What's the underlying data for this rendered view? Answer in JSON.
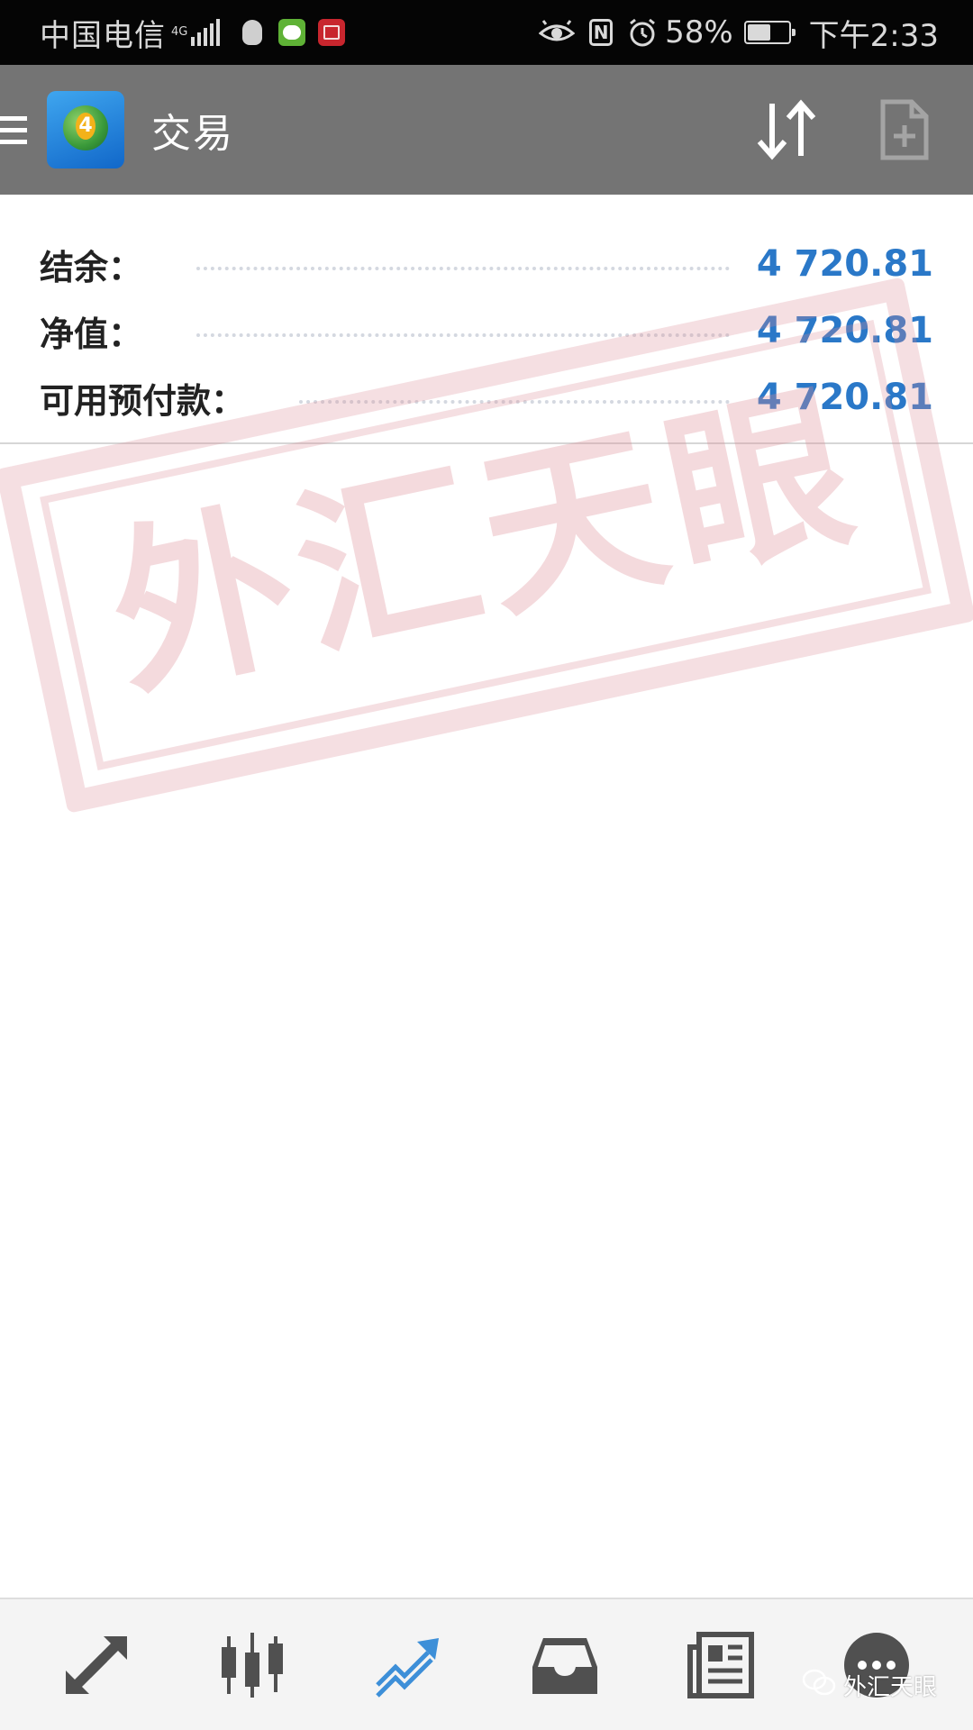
{
  "status_bar": {
    "carrier": "中国电信",
    "network_type": "4G",
    "battery_level": "58%",
    "time": "下午2:33",
    "icons": [
      "signal-icon",
      "qq-icon",
      "pet-app-icon",
      "book-app-icon",
      "eye-icon",
      "nfc-icon",
      "alarm-icon",
      "battery-icon"
    ],
    "nfc_glyph": "N"
  },
  "toolbar": {
    "title": "交易",
    "app_logo_number": "4",
    "icons": [
      "menu-icon",
      "sort-icon",
      "new-order-icon"
    ]
  },
  "account": {
    "rows": [
      {
        "label": "结余：",
        "value": "4 720.81"
      },
      {
        "label": "净值：",
        "value": "4 720.81"
      },
      {
        "label": "可用预付款：",
        "value": "4 720.81"
      }
    ]
  },
  "watermark": {
    "text": "外汇天眼"
  },
  "bottom_nav": {
    "items": [
      "quotes-icon",
      "chart-icon",
      "trade-icon",
      "history-icon",
      "news-icon",
      "more-icon"
    ],
    "active": "trade-icon"
  },
  "footer_credit": {
    "text": "外汇天眼"
  },
  "colors": {
    "toolbar_bg": "#747474",
    "value_blue": "#2a78c8",
    "active_nav": "#3d8fd8",
    "inactive_nav": "#505050",
    "stamp": "#dc8c96"
  }
}
